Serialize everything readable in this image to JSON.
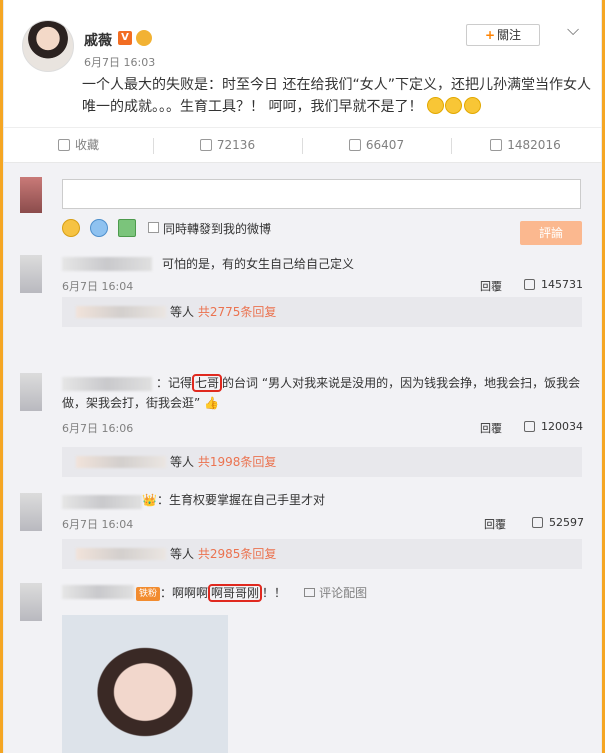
{
  "post": {
    "author": "戚薇",
    "verified_badge": "V",
    "time": "6月7日 16:03",
    "follow_label": "關注",
    "text": "一个人最大的失败是：时至今日 还在给我们“女人”下定义，还把儿孙满堂当作女人唯一的成就。。。生育工具？！ 呵呵，我们早就不是了！",
    "emojis": [
      "cool-face-emoji",
      "cool-face-emoji",
      "cool-face-emoji"
    ]
  },
  "actions": {
    "collect": "收藏",
    "forward": "72136",
    "comment": "66407",
    "like": "1482016"
  },
  "composer": {
    "sync_label": "同時轉發到我的微博",
    "submit_label": "評論"
  },
  "comments": [
    {
      "text": "可怕的是，有的女生自己给自己定义",
      "time": "6月7日 16:04",
      "reply_label": "回覆",
      "likes": "145731",
      "thread_pre": "等人",
      "thread_more": "共2775条回复"
    },
    {
      "text_before": "：记得",
      "text_highlight": "七哥",
      "text_after": "的台词 “男人对我来说是没用的，因为钱我会挣，地我会扫，饭我会做，架我会打，街我会逛”",
      "time": "6月7日 16:06",
      "reply_label": "回覆",
      "likes": "120034",
      "thread_pre": "等人",
      "thread_more": "共1998条回复"
    },
    {
      "text": "：生育权要掌握在自己手里才对",
      "time": "6月7日 16:04",
      "reply_label": "回覆",
      "likes": "52597",
      "thread_pre": "等人",
      "thread_more": "共2985条回复"
    },
    {
      "badge": "铁粉",
      "text_before": "：啊啊啊",
      "text_highlight": "啊哥哥刚",
      "text_after": "！！",
      "pic_link": "评论配图"
    }
  ],
  "colors": {
    "accent": "#ff8200",
    "link": "#eb7350",
    "highlight_box": "#e0291f",
    "submit_disabled": "#fbb88f",
    "edge": "#f5a623"
  }
}
